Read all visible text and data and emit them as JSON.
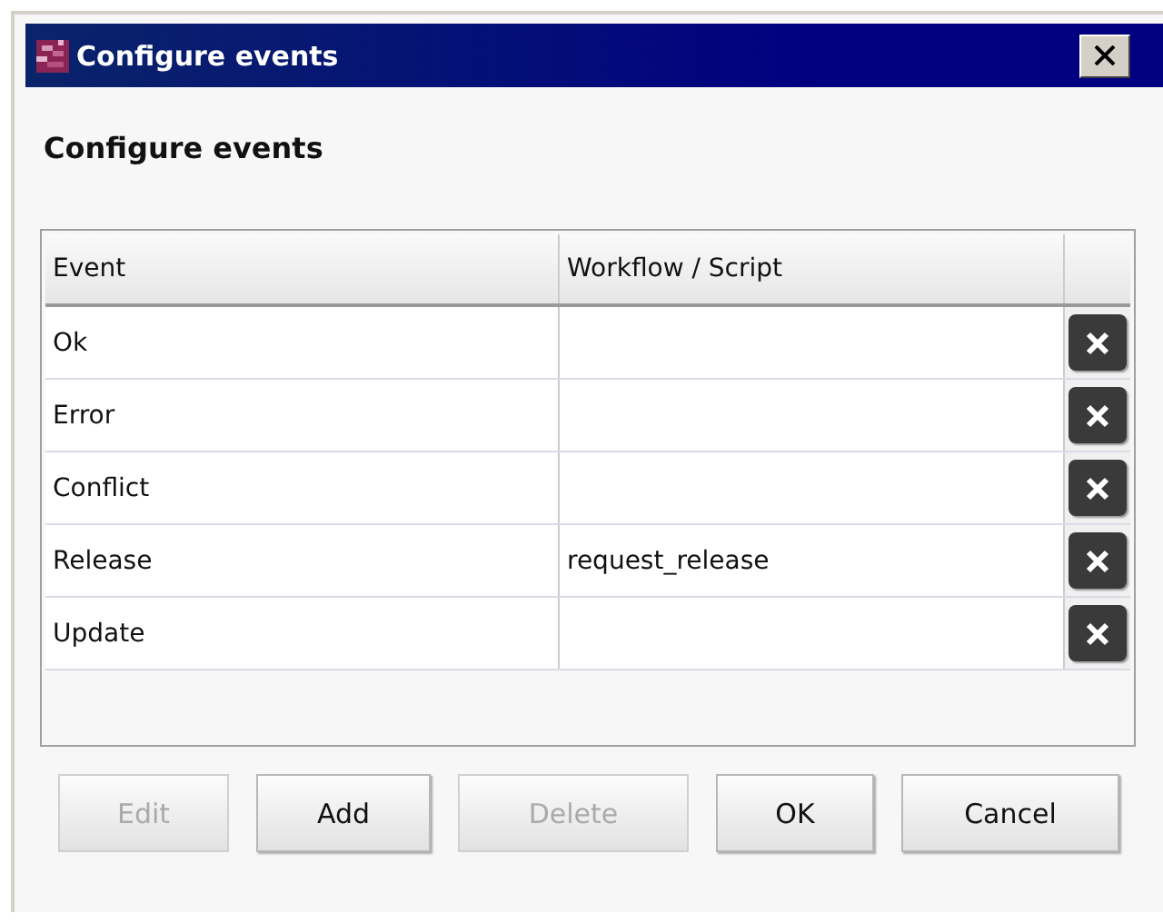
{
  "window": {
    "title": "Configure events"
  },
  "heading": "Configure events",
  "table": {
    "columns": [
      "Event",
      "Workflow / Script"
    ],
    "rows": [
      {
        "event": "Ok",
        "script": ""
      },
      {
        "event": "Error",
        "script": ""
      },
      {
        "event": "Conflict",
        "script": ""
      },
      {
        "event": "Release",
        "script": "request_release"
      },
      {
        "event": "Update",
        "script": ""
      }
    ]
  },
  "buttons": [
    {
      "label": "Edit",
      "disabled": true
    },
    {
      "label": "Add",
      "disabled": false
    },
    {
      "label": "Delete",
      "disabled": true
    },
    {
      "label": "OK",
      "disabled": false
    },
    {
      "label": "Cancel",
      "disabled": false
    }
  ]
}
